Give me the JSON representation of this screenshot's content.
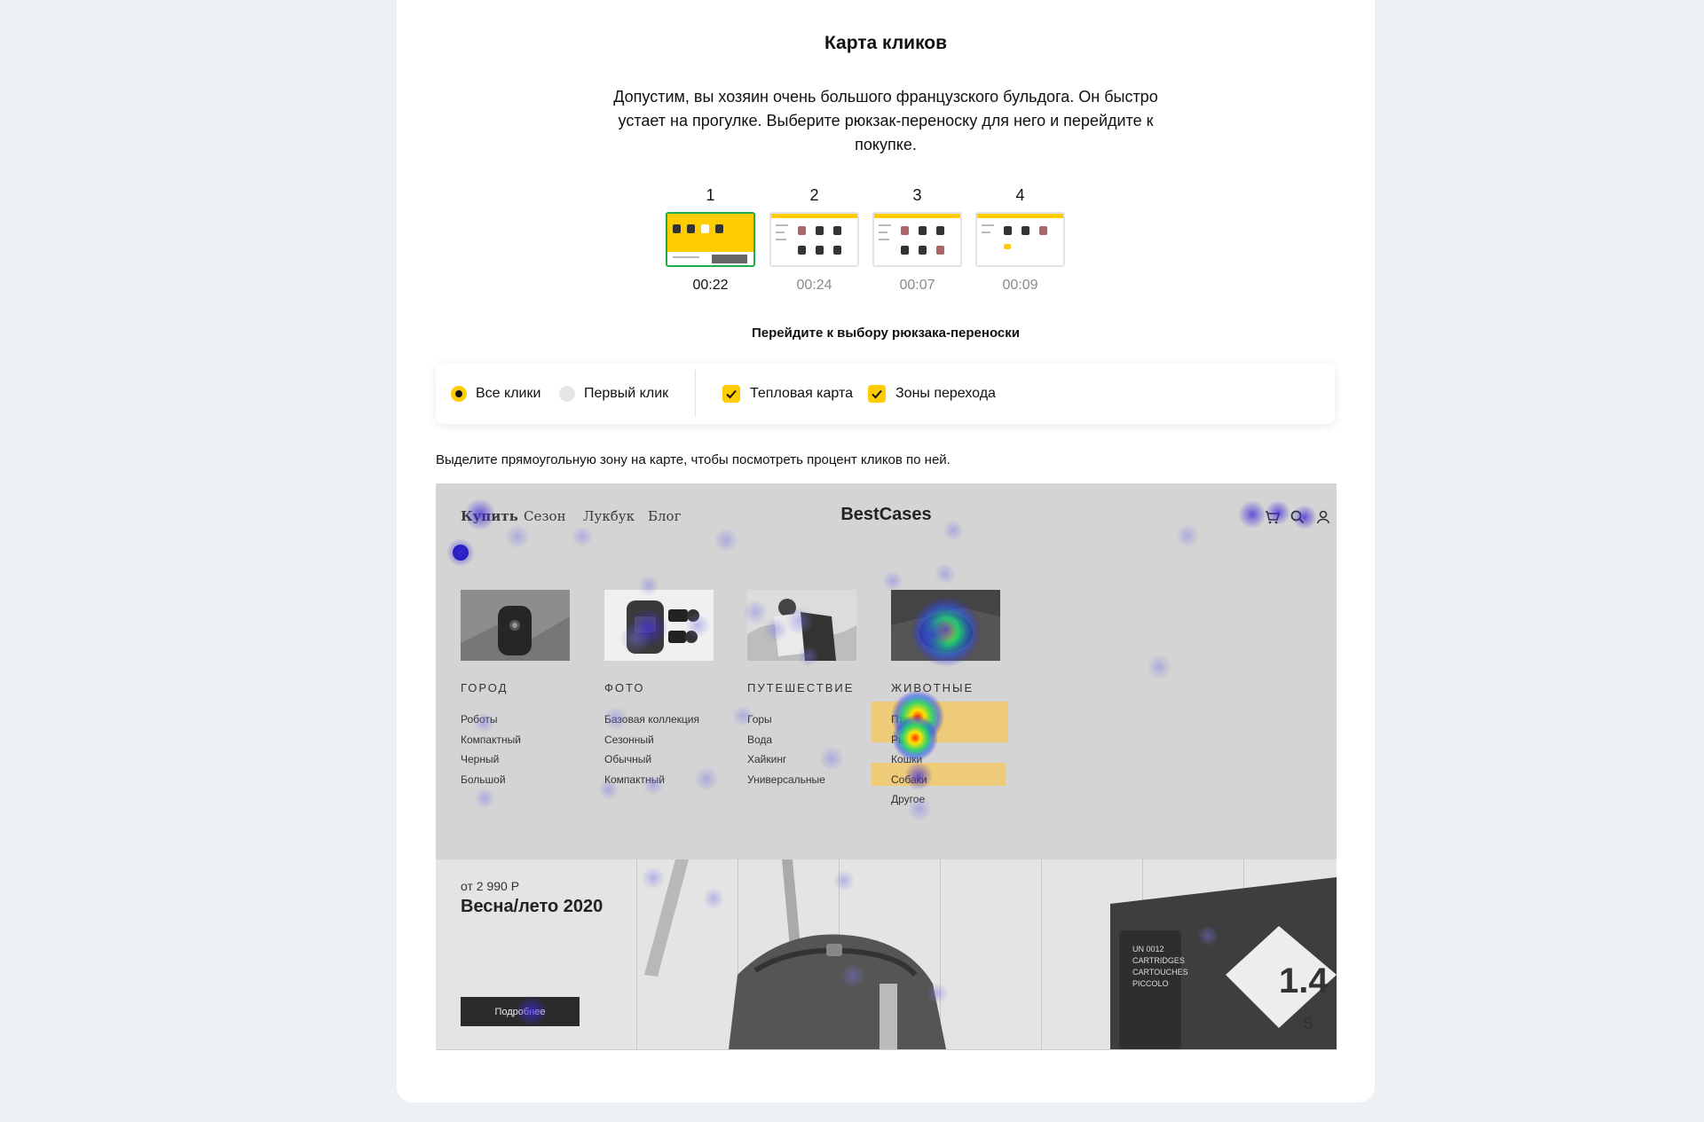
{
  "page": {
    "title": "Карта кликов",
    "description": "Допустим, вы хозяин очень большого французского бульдога. Он быстро устает на прогулке. Выберите рюкзак-переноску для него и перейдите к покупке.",
    "task_label": "Перейдите к выбору рюкзака-переноски",
    "hint": "Выделите прямоугольную зону на карте, чтобы посмотреть процент кликов по ней."
  },
  "steps": [
    {
      "num": "1",
      "time": "00:22",
      "active": true
    },
    {
      "num": "2",
      "time": "00:24",
      "active": false
    },
    {
      "num": "3",
      "time": "00:07",
      "active": false
    },
    {
      "num": "4",
      "time": "00:09",
      "active": false
    }
  ],
  "filters": {
    "all_clicks": "Все клики",
    "first_click": "Первый клик",
    "heatmap": "Тепловая карта",
    "zones": "Зоны перехода",
    "selected_radio": "all_clicks",
    "heatmap_checked": true,
    "zones_checked": true
  },
  "site": {
    "brand": "BestCases",
    "nav": [
      "Купить",
      "Сезон",
      "Лукбук",
      "Блог"
    ],
    "icons": [
      "cart-icon",
      "search-icon",
      "user-icon"
    ],
    "columns": [
      {
        "heading": "ГОРОД",
        "items": [
          "Роботы",
          "Компактный",
          "Черный",
          "Большой"
        ]
      },
      {
        "heading": "ФОТО",
        "items": [
          "Базовая коллекция",
          "Сезонный",
          "Обычный",
          "Компактный"
        ]
      },
      {
        "heading": "ПУТЕШЕСТВИЕ",
        "items": [
          "Горы",
          "Вода",
          "Хайкинг",
          "Универсальные"
        ]
      },
      {
        "heading": "ЖИВОТНЫЕ",
        "items": [
          "Птицы",
          "Рыбки",
          "Кошки",
          "Собаки",
          "Другое"
        ]
      }
    ],
    "banner": {
      "price": "от 2 990 Р",
      "season": "Весна/лето 2020",
      "button": "Подробнее",
      "box_text": "UN 0012 CARTRIDGES CARTOUCHES PICCOLO",
      "big_number": "1.4",
      "letter": "S"
    }
  },
  "colors": {
    "accent": "#ffcc00",
    "active_step": "#1fab46",
    "zone": "#f1c967",
    "heat_low": "#3c28d8",
    "heat_mid": "#22d36a",
    "heat_high": "#ff2a00"
  }
}
